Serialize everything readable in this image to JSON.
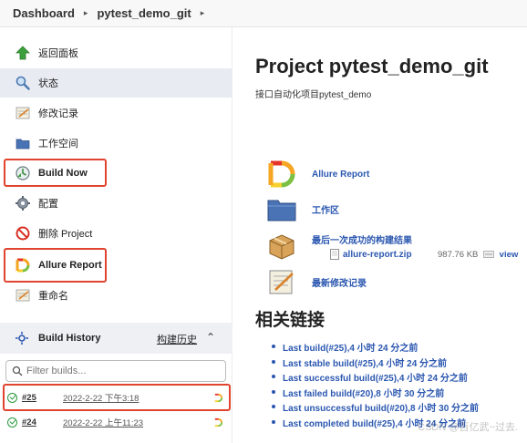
{
  "breadcrumb": [
    "Dashboard",
    "pytest_demo_git"
  ],
  "sidebar": {
    "items": [
      {
        "label": "返回面板",
        "icon": "up-arrow-icon"
      },
      {
        "label": "状态",
        "icon": "search-icon"
      },
      {
        "label": "修改记录",
        "icon": "notepad-icon"
      },
      {
        "label": "工作空间",
        "icon": "folder-icon"
      },
      {
        "label": "Build Now",
        "icon": "build-clock-icon"
      },
      {
        "label": "配置",
        "icon": "gear-icon"
      },
      {
        "label": "删除 Project",
        "icon": "no-entry-icon"
      },
      {
        "label": "Allure Report",
        "icon": "allure-logo-icon"
      },
      {
        "label": "重命名",
        "icon": "notepad-icon"
      }
    ]
  },
  "build_history": {
    "title": "Build History",
    "trend_label": "构建历史",
    "filter_placeholder": "Filter builds...",
    "builds": [
      {
        "number": "#25",
        "date": "2022-2-22 下午3:18"
      },
      {
        "number": "#24",
        "date": "2022-2-22 上午11:23"
      }
    ]
  },
  "main": {
    "title": "Project pytest_demo_git",
    "description": "接口自动化项目pytest_demo",
    "actions": {
      "allure": "Allure Report",
      "workspace": "工作区",
      "last_success": "最后一次成功的构建结果",
      "changes": "最新修改记录"
    },
    "artifact": {
      "file": "allure-report.zip",
      "size": "987.76 KB",
      "view": "view"
    },
    "links_title": "相关链接",
    "links": [
      "Last build(#25),4 小时 24 分之前",
      "Last stable build(#25),4 小时 24 分之前",
      "Last successful build(#25),4 小时 24 分之前",
      "Last failed build(#20),8 小时 30 分之前",
      "Last unsuccessful build(#20),8 小时 30 分之前",
      "Last completed build(#25),4 小时 24 分之前"
    ]
  },
  "watermark": "CSDN @百亿武~过去.",
  "colors": {
    "accent_link": "#2b57b0",
    "highlight_border": "#e0442e",
    "active_bg": "#e8ebf2"
  }
}
